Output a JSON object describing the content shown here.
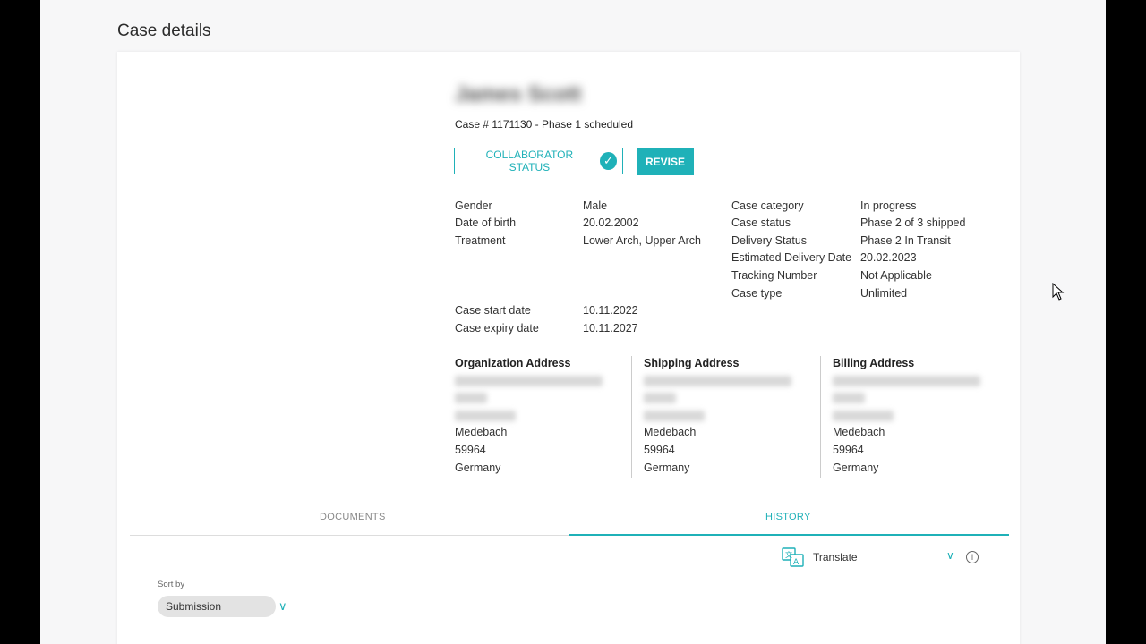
{
  "page": {
    "title": "Case details"
  },
  "patient": {
    "name": "James Scott",
    "case_line": "Case # 1171130 - Phase 1 scheduled"
  },
  "buttons": {
    "collaborator_status": "COLLABORATOR STATUS",
    "revise": "REVISE"
  },
  "left_details": [
    {
      "label": "Gender",
      "value": "Male"
    },
    {
      "label": "Date of birth",
      "value": "20.02.2002"
    },
    {
      "label": "Treatment",
      "value": "Lower Arch, Upper Arch"
    }
  ],
  "right_details": [
    {
      "label": "Case category",
      "value": "In progress"
    },
    {
      "label": "Case status",
      "value": "Phase 2 of 3 shipped"
    },
    {
      "label": "Delivery Status",
      "value": "Phase 2  In Transit"
    },
    {
      "label": "Estimated Delivery Date",
      "value": "20.02.2023"
    },
    {
      "label": "Tracking Number",
      "value": "Not Applicable"
    },
    {
      "label": "Case type",
      "value": "Unlimited"
    }
  ],
  "dates": [
    {
      "label": "Case start date",
      "value": "10.11.2022"
    },
    {
      "label": "Case expiry date",
      "value": "10.11.2027"
    }
  ],
  "addresses": [
    {
      "heading": "Organization Address",
      "city": "Medebach",
      "zip": "59964",
      "country": "Germany"
    },
    {
      "heading": "Shipping Address",
      "city": "Medebach",
      "zip": "59964",
      "country": "Germany"
    },
    {
      "heading": "Billing Address",
      "city": "Medebach",
      "zip": "59964",
      "country": "Germany"
    }
  ],
  "tabs": {
    "documents": "DOCUMENTS",
    "history": "HISTORY"
  },
  "translate": {
    "label": "Translate",
    "icon": "translate-icon"
  },
  "sort": {
    "label": "Sort by",
    "value": "Submission"
  },
  "colors": {
    "accent": "#1fb1b8"
  }
}
